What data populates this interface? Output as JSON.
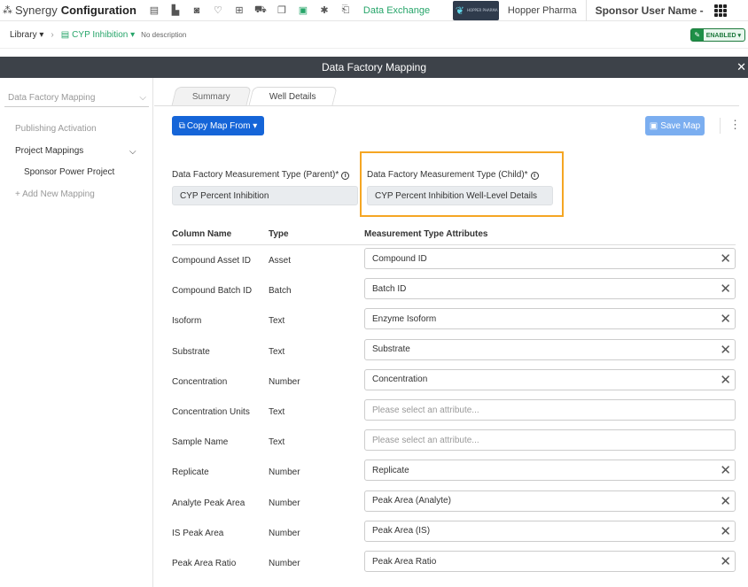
{
  "nav": {
    "app_name": "Synergy",
    "section": "Configuration",
    "data_exchange": "Data Exchange",
    "company": "Hopper Pharma",
    "user": "Sponsor User Name -",
    "logo_tiny": "HOPPER PHARMA",
    "icons": [
      "team-icon",
      "report-icon",
      "building-icon",
      "camera-icon",
      "lightbulb-icon",
      "table-icon",
      "vehicle-icon",
      "files-icon",
      "document-icon",
      "gear-icon",
      "export-icon"
    ]
  },
  "breadcrumb": {
    "library": "Library ▾",
    "current": "CYP Inhibition ▾",
    "description": "No description",
    "status": "ENABLED ▾"
  },
  "titlebar": {
    "title": "Data Factory Mapping",
    "close": "✕"
  },
  "sidebar": {
    "select_value": "Data Factory Mapping",
    "publishing": "Publishing Activation",
    "project_mappings": "Project Mappings",
    "project": "Sponsor Power Project",
    "add_new": "+ Add New Mapping"
  },
  "tabs": [
    {
      "label": "Summary"
    },
    {
      "label": "Well Details"
    }
  ],
  "toolbar": {
    "copy_label": "Copy Map From ▾",
    "save_label": "Save Map"
  },
  "measurement": {
    "parent_label": "Data Factory Measurement Type (Parent)*",
    "parent_value": "CYP Percent Inhibition",
    "child_label": "Data Factory Measurement Type (Child)*",
    "child_value": "CYP Percent Inhibition Well-Level Details"
  },
  "table": {
    "headers": {
      "column": "Column Name",
      "type": "Type",
      "attr": "Measurement Type Attributes"
    },
    "rows": [
      {
        "name": "Compound Asset ID",
        "type": "Asset",
        "attr": "Compound ID",
        "clearable": true
      },
      {
        "name": "Compound Batch ID",
        "type": "Batch",
        "attr": "Batch ID",
        "clearable": true
      },
      {
        "name": "Isoform",
        "type": "Text",
        "attr": "Enzyme Isoform",
        "clearable": true
      },
      {
        "name": "Substrate",
        "type": "Text",
        "attr": "Substrate",
        "clearable": true
      },
      {
        "name": "Concentration",
        "type": "Number",
        "attr": "Concentration",
        "clearable": true
      },
      {
        "name": "Concentration Units",
        "type": "Text",
        "attr": "",
        "placeholder": "Please select an attribute...",
        "clearable": false
      },
      {
        "name": "Sample Name",
        "type": "Text",
        "attr": "",
        "placeholder": "Please select an attribute...",
        "clearable": false
      },
      {
        "name": "Replicate",
        "type": "Number",
        "attr": "Replicate",
        "clearable": true
      },
      {
        "name": "Analyte Peak Area",
        "type": "Number",
        "attr": "Peak Area (Analyte)",
        "clearable": true
      },
      {
        "name": "IS Peak Area",
        "type": "Number",
        "attr": "Peak Area (IS)",
        "clearable": true
      },
      {
        "name": "Peak Area Ratio",
        "type": "Number",
        "attr": "Peak Area Ratio",
        "clearable": true
      }
    ]
  },
  "colors": {
    "brand_green": "#27a56a",
    "primary_blue": "#1565d8",
    "highlight": "#f5a623",
    "titlebar": "#3d4249"
  }
}
